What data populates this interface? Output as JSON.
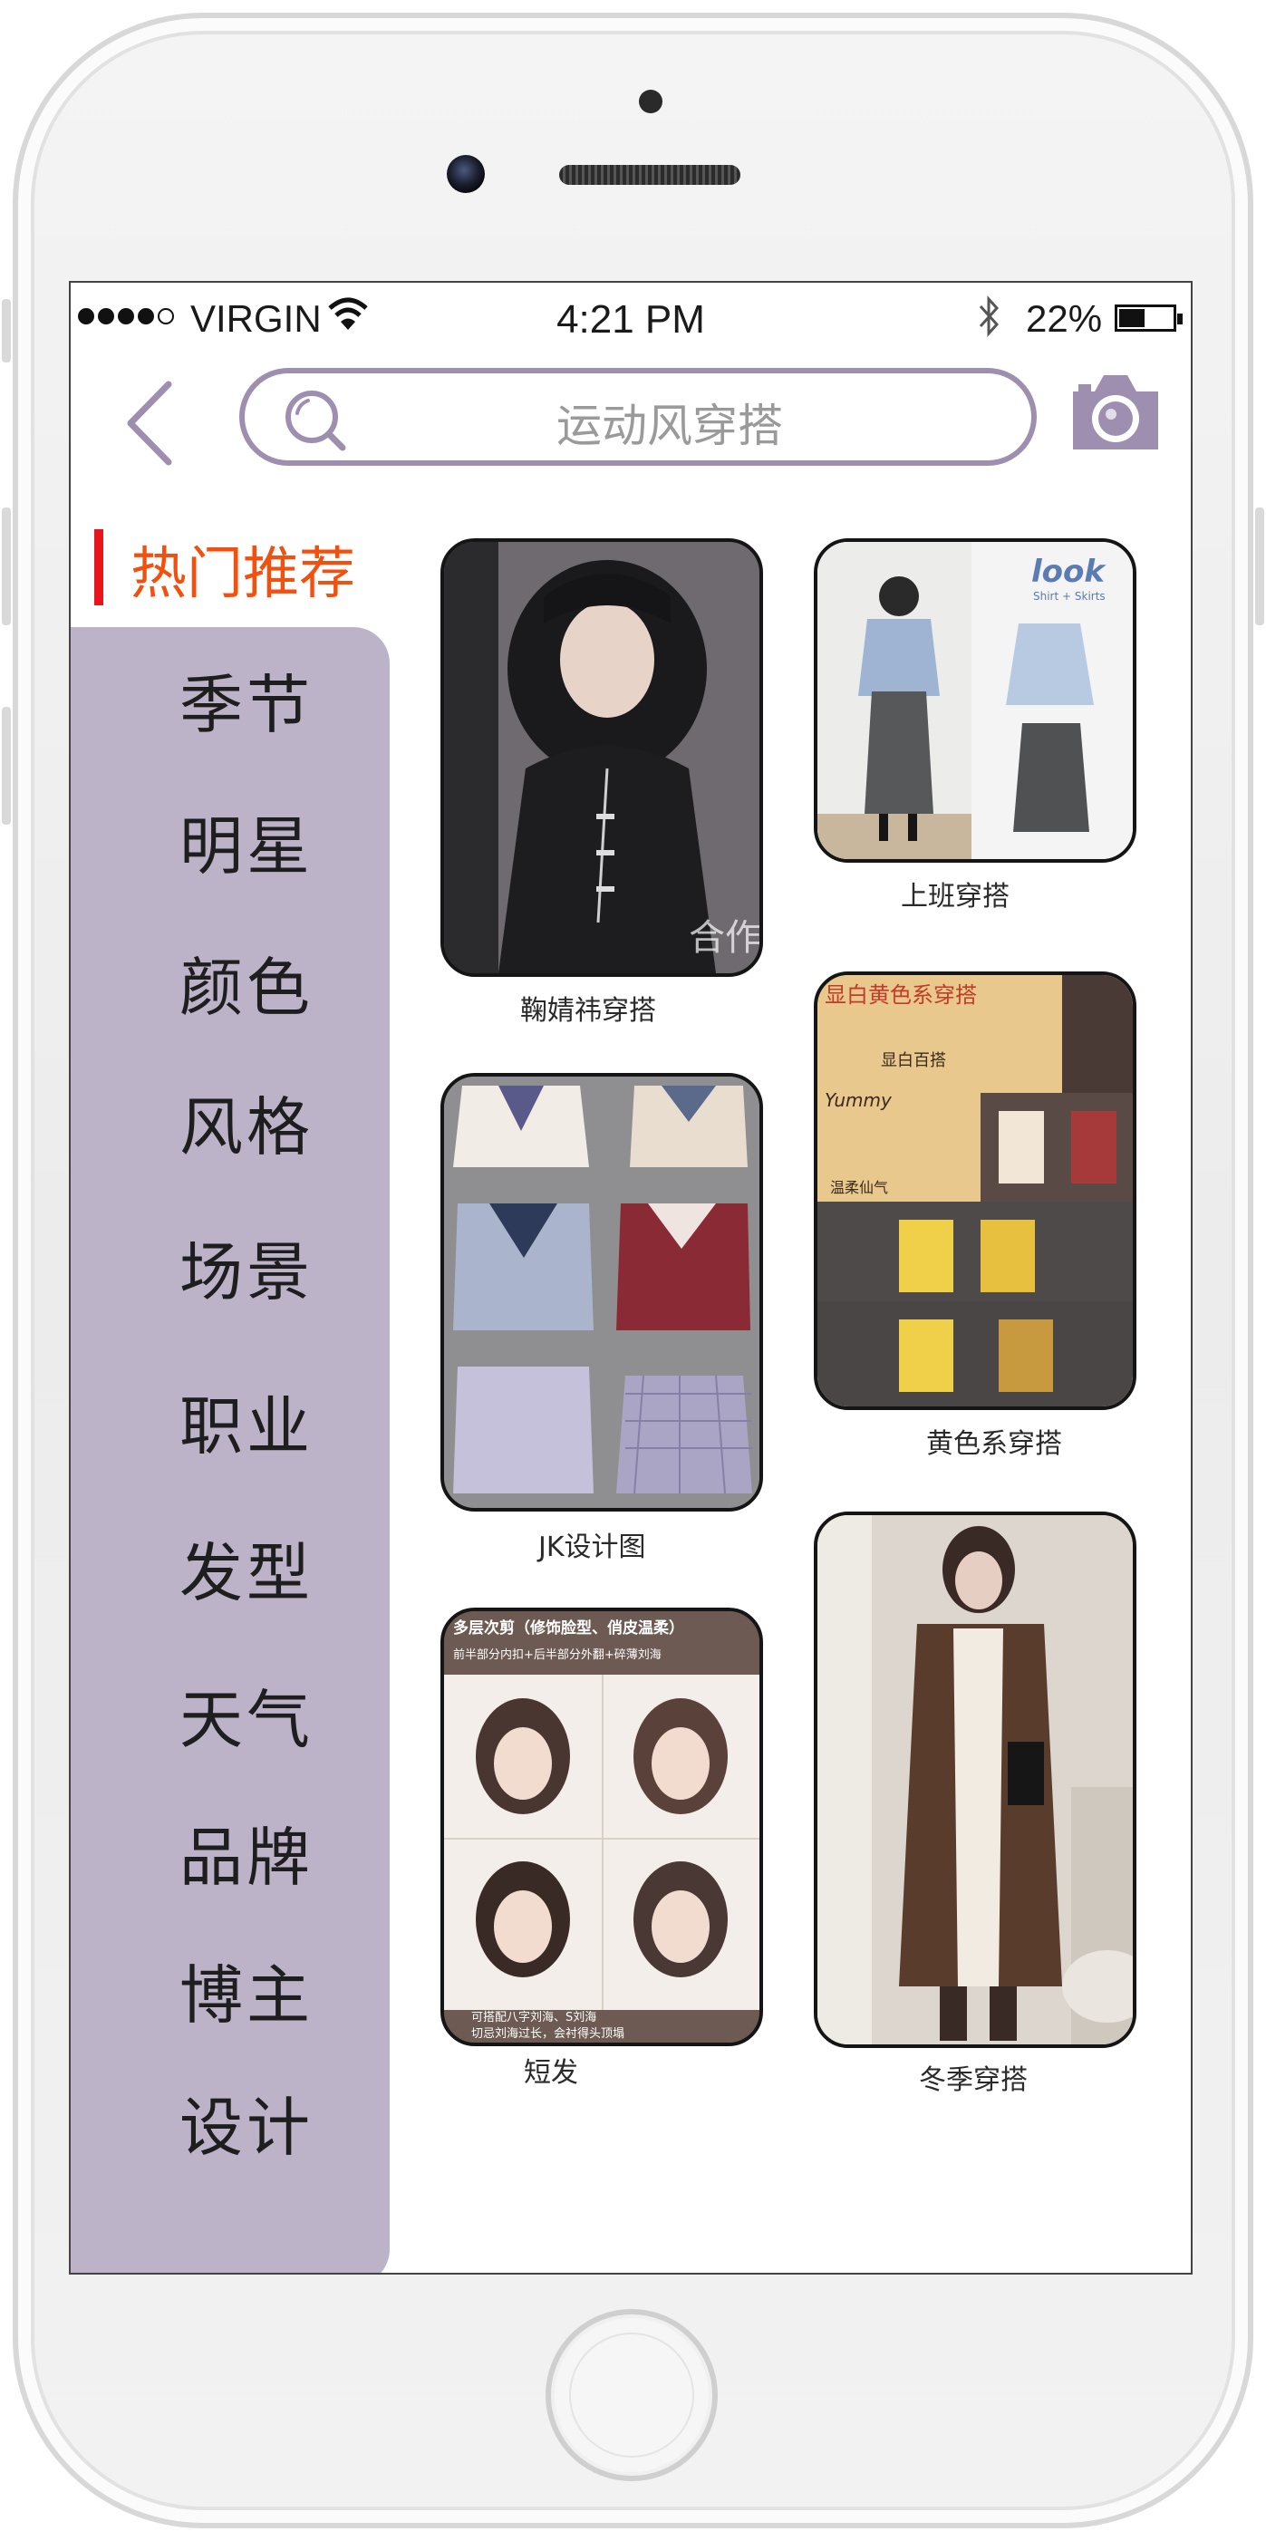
{
  "status_bar": {
    "carrier": "VIRGIN",
    "time": "4:21 PM",
    "battery_percent_text": "22%",
    "battery_level": 0.22,
    "signal_bars_filled": 4,
    "signal_bars_total": 5
  },
  "search": {
    "query": "运动风穿搭"
  },
  "section_title": "热门推荐",
  "categories": [
    "季节",
    "明星",
    "颜色",
    "风格",
    "场景",
    "职业",
    "发型",
    "天气",
    "品牌",
    "博主",
    "设计"
  ],
  "cards": [
    {
      "caption": "鞠婧祎穿搭",
      "image_overlay": "合作"
    },
    {
      "caption": "上班穿搭",
      "image_overlay": "look",
      "image_overlay_sub": "Shirt + Skirts"
    },
    {
      "caption": "JK设计图"
    },
    {
      "caption": "黄色系穿搭",
      "image_overlay": "显白黄色系穿搭",
      "image_overlay_2": "显白百搭",
      "image_overlay_3": "Yummy",
      "image_overlay_4": "温柔仙气"
    },
    {
      "caption": "短发",
      "image_overlay": "多层次剪（修饰脸型、俏皮温柔）",
      "image_overlay_sub": "前半部分内扣+后半部分外翻+碎薄刘海",
      "image_overlay_foot": "可搭配八字刘海、S刘海",
      "image_overlay_foot2": "切忌刘海过长，会衬得头顶塌"
    },
    {
      "caption": "冬季穿搭"
    }
  ],
  "colors": {
    "accent_purple": "#9e8fb1",
    "sidebar_bg": "#bdb3c9",
    "section_title": "#f2500f",
    "section_marker": "#e8161c"
  },
  "icons": [
    "back-chevron-icon",
    "search-icon",
    "camera-icon",
    "wifi-icon",
    "bluetooth-icon",
    "battery-icon"
  ]
}
